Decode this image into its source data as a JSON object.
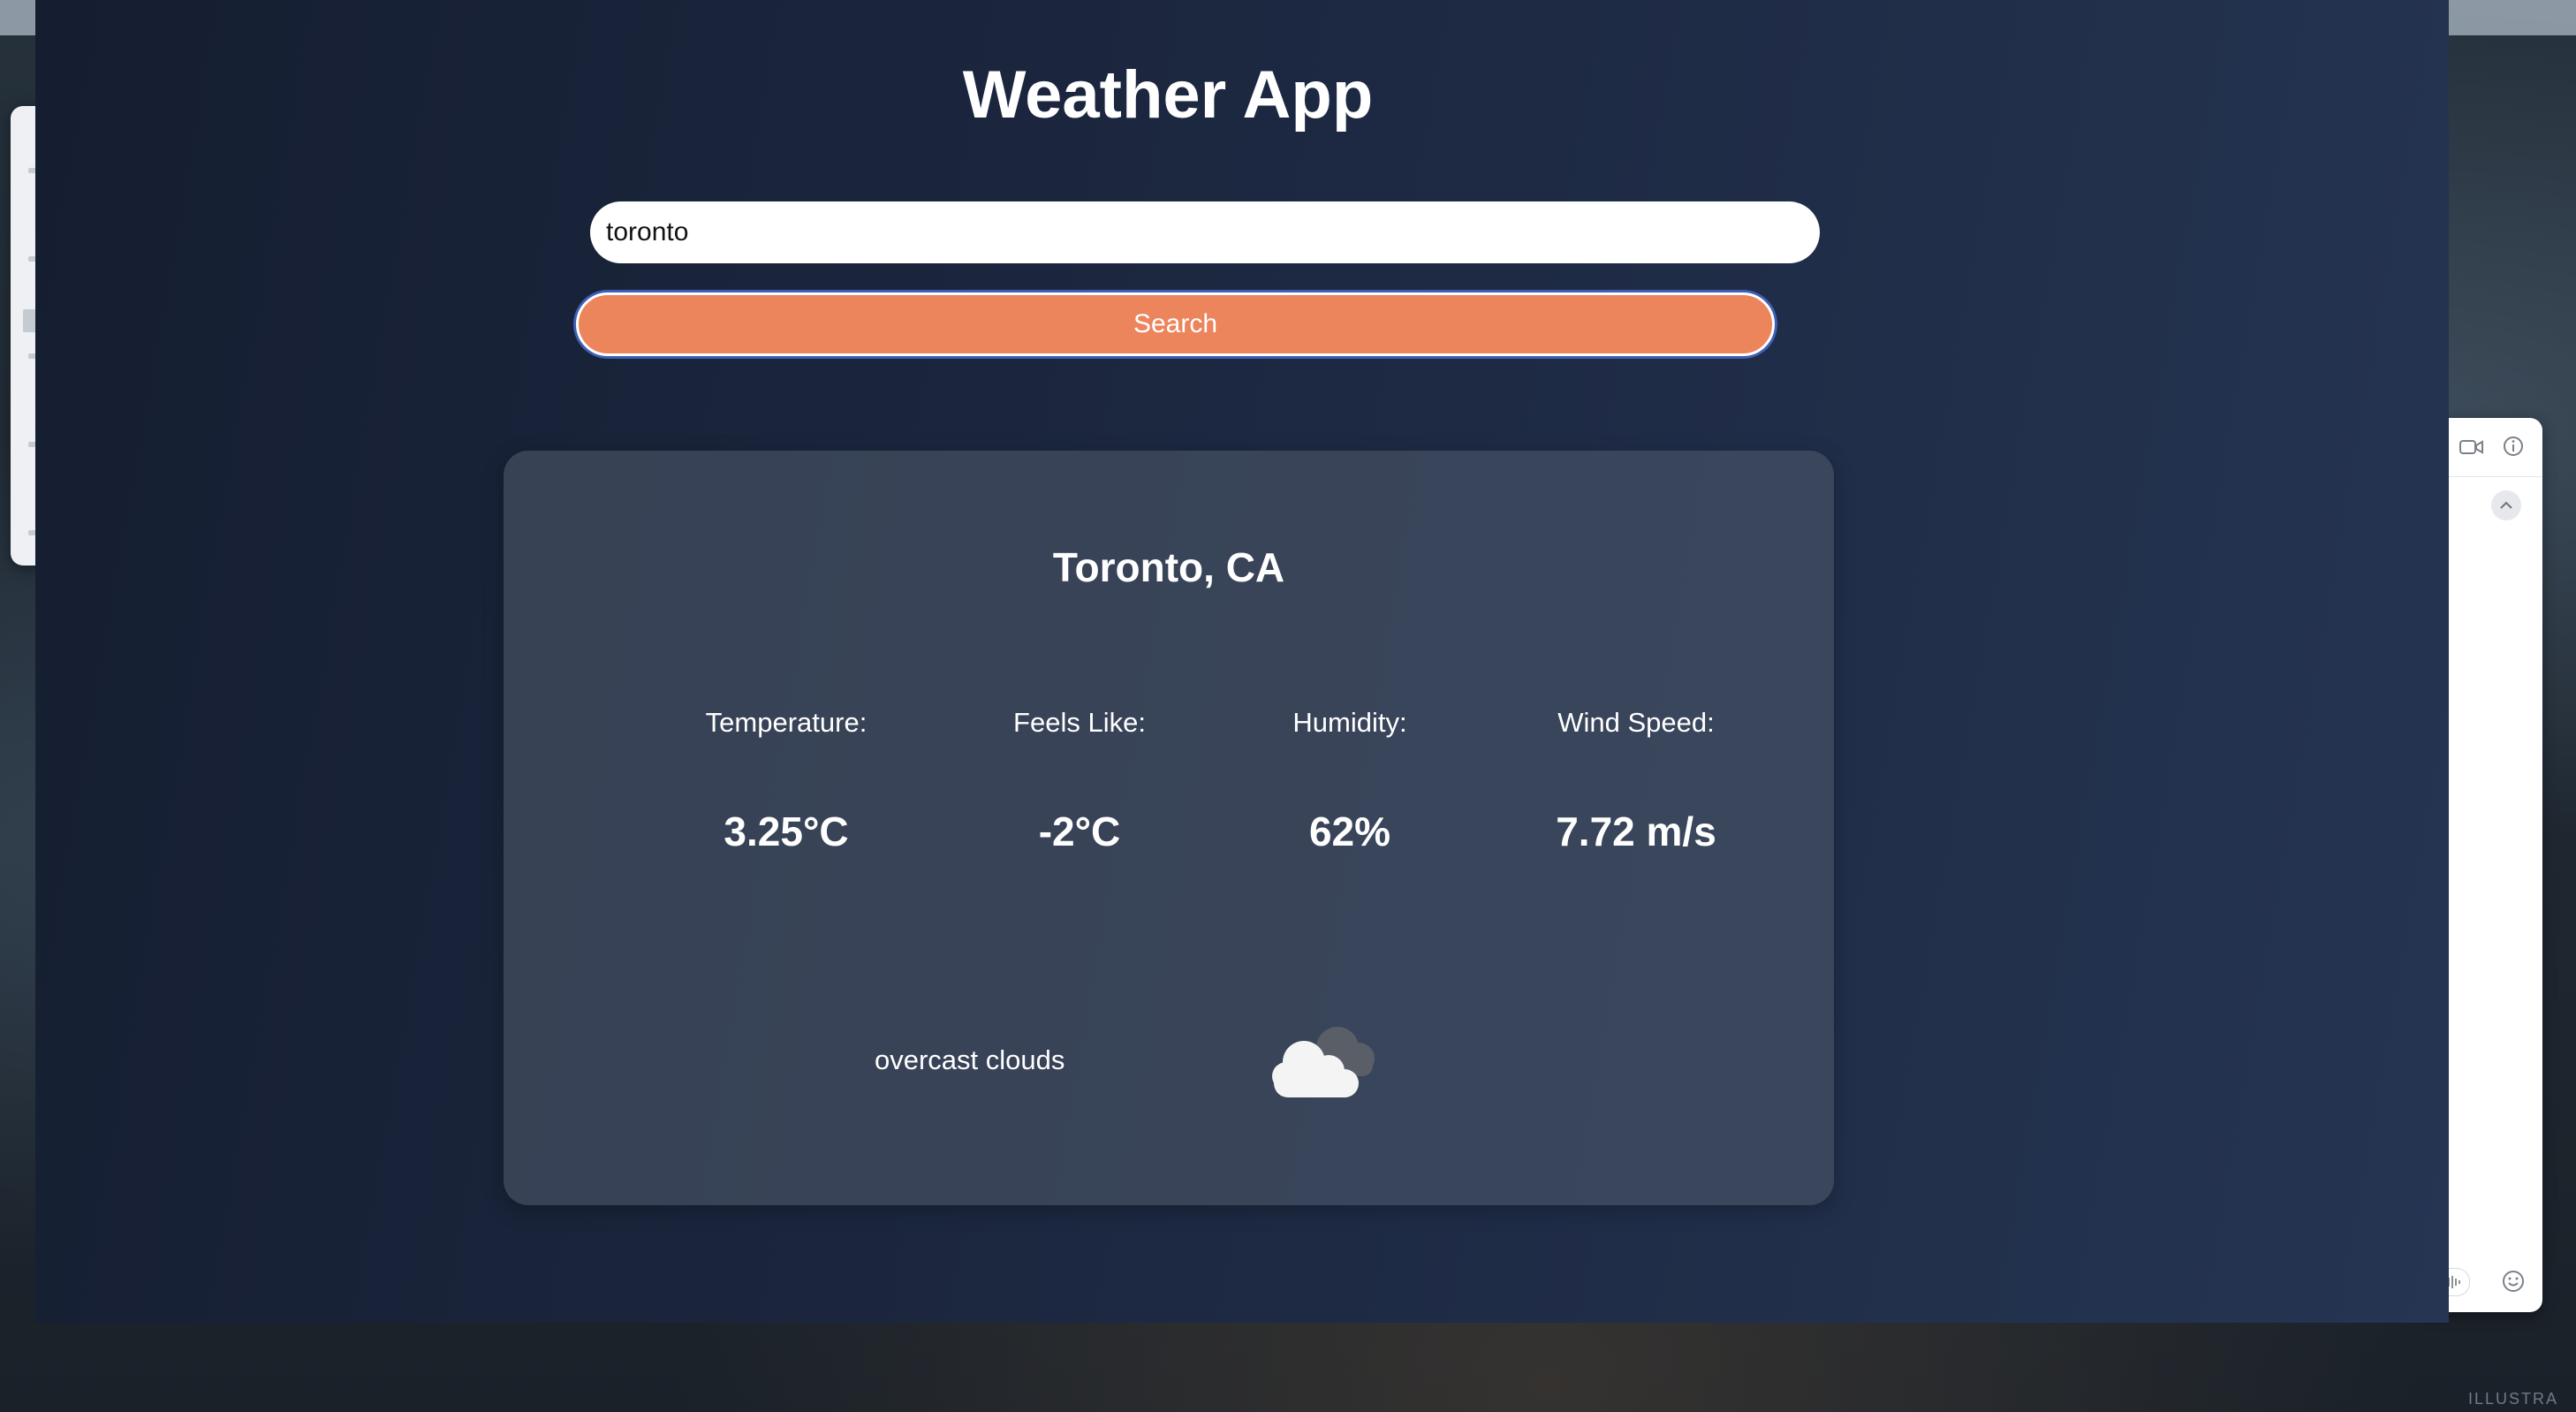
{
  "app": {
    "title": "Weather App"
  },
  "search": {
    "value": "toronto",
    "button_label": "Search"
  },
  "weather": {
    "city": "Toronto, CA",
    "metrics": [
      {
        "label": "Temperature:",
        "value": "3.25°C"
      },
      {
        "label": "Feels Like:",
        "value": "-2°C"
      },
      {
        "label": "Humidity:",
        "value": "62%"
      },
      {
        "label": "Wind Speed:",
        "value": "7.72 m/s"
      }
    ],
    "description": "overcast clouds",
    "icon": "overcast-clouds-icon"
  },
  "colors": {
    "accent": "#ec845c",
    "card": "#4a5668",
    "window_bg": "#1c2740"
  },
  "desktop": {
    "caption": "ILLUSTRA"
  }
}
